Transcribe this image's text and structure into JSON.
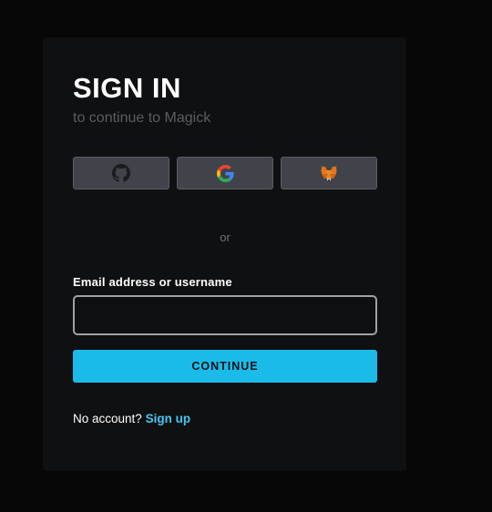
{
  "header": {
    "title": "SIGN IN",
    "subtitle": "to continue to Magick"
  },
  "social": [
    {
      "provider": "GitHub",
      "icon": "github-icon"
    },
    {
      "provider": "Google",
      "icon": "google-icon"
    },
    {
      "provider": "MetaMask",
      "icon": "metamask-fox-icon"
    }
  ],
  "divider": {
    "text": "or"
  },
  "form": {
    "email_label": "Email address or username",
    "email_value": "",
    "email_placeholder": "",
    "continue_label": "CONTINUE"
  },
  "footer": {
    "prompt": "No account?",
    "signup_label": "Sign up"
  },
  "colors": {
    "background": "#070707",
    "card": "#0f1012",
    "accent": "#1bbbe9",
    "link": "#48c7ee",
    "social_button": "#404349"
  }
}
